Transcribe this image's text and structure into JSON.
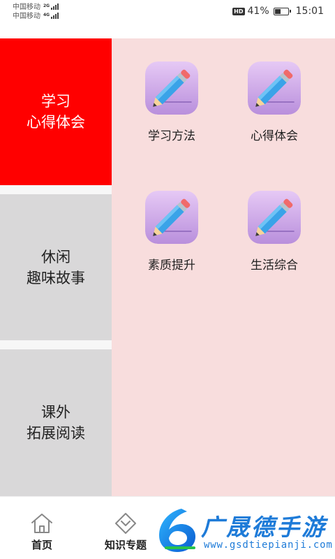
{
  "status_bar": {
    "carrier_1": "中国移动",
    "carrier_1_network": "2G",
    "carrier_2": "中国移动",
    "carrier_2_network": "4G",
    "hd_badge": "HD",
    "battery_percent": "41%",
    "battery_level": 0.41,
    "time": "15:01"
  },
  "sidebar": {
    "items": [
      {
        "line1": "学习",
        "line2": "心得体会",
        "active": true
      },
      {
        "line1": "休闲",
        "line2": "趣味故事",
        "active": false
      },
      {
        "line1": "课外",
        "line2": "拓展阅读",
        "active": false
      }
    ]
  },
  "content": {
    "tiles": [
      {
        "label": "学习方法",
        "icon": "pencil-icon"
      },
      {
        "label": "心得体会",
        "icon": "pencil-icon"
      },
      {
        "label": "素质提升",
        "icon": "pencil-icon"
      },
      {
        "label": "生活综合",
        "icon": "pencil-icon"
      }
    ]
  },
  "tab_bar": {
    "tabs": [
      {
        "label": "首页",
        "icon": "home-icon"
      },
      {
        "label": "知识专题",
        "icon": "diamond-chevron-icon"
      }
    ]
  },
  "watermark": {
    "title": "广晟德手游",
    "url": "www.gsdtiepianji.com"
  },
  "colors": {
    "active_category": "#ff0000",
    "inactive_category": "#d9d8d9",
    "content_background": "#f8dddd",
    "watermark_blue": "#1e7bd8"
  }
}
